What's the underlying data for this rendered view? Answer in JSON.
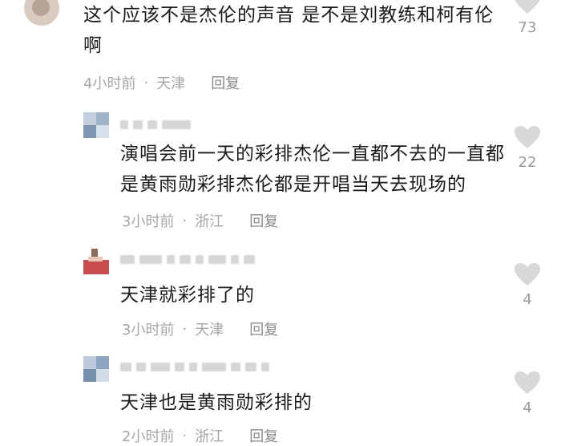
{
  "comments": [
    {
      "text": "这个应该不是杰伦的声音 是不是刘教练和柯有伦啊",
      "time": "4小时前",
      "dot": "·",
      "location": "天津",
      "reply": "回复",
      "likes": "73"
    },
    {
      "text": "演唱会前一天的彩排杰伦一直都不去的一直都是黄雨勋彩排杰伦都是开唱当天去现场的",
      "time": "3小时前",
      "dot": "·",
      "location": "浙江",
      "reply": "回复",
      "likes": "22"
    },
    {
      "text": "天津就彩排了的",
      "time": "3小时前",
      "dot": "·",
      "location": "天津",
      "reply": "回复",
      "likes": "4"
    },
    {
      "text": "天津也是黄雨勋彩排的",
      "time": "2小时前",
      "dot": "·",
      "location": "浙江",
      "reply": "回复",
      "likes": "4"
    }
  ],
  "icons": {
    "like": "heart-icon"
  },
  "colors": {
    "heart": "#d8d8d8",
    "meta": "#a6a6a6"
  }
}
